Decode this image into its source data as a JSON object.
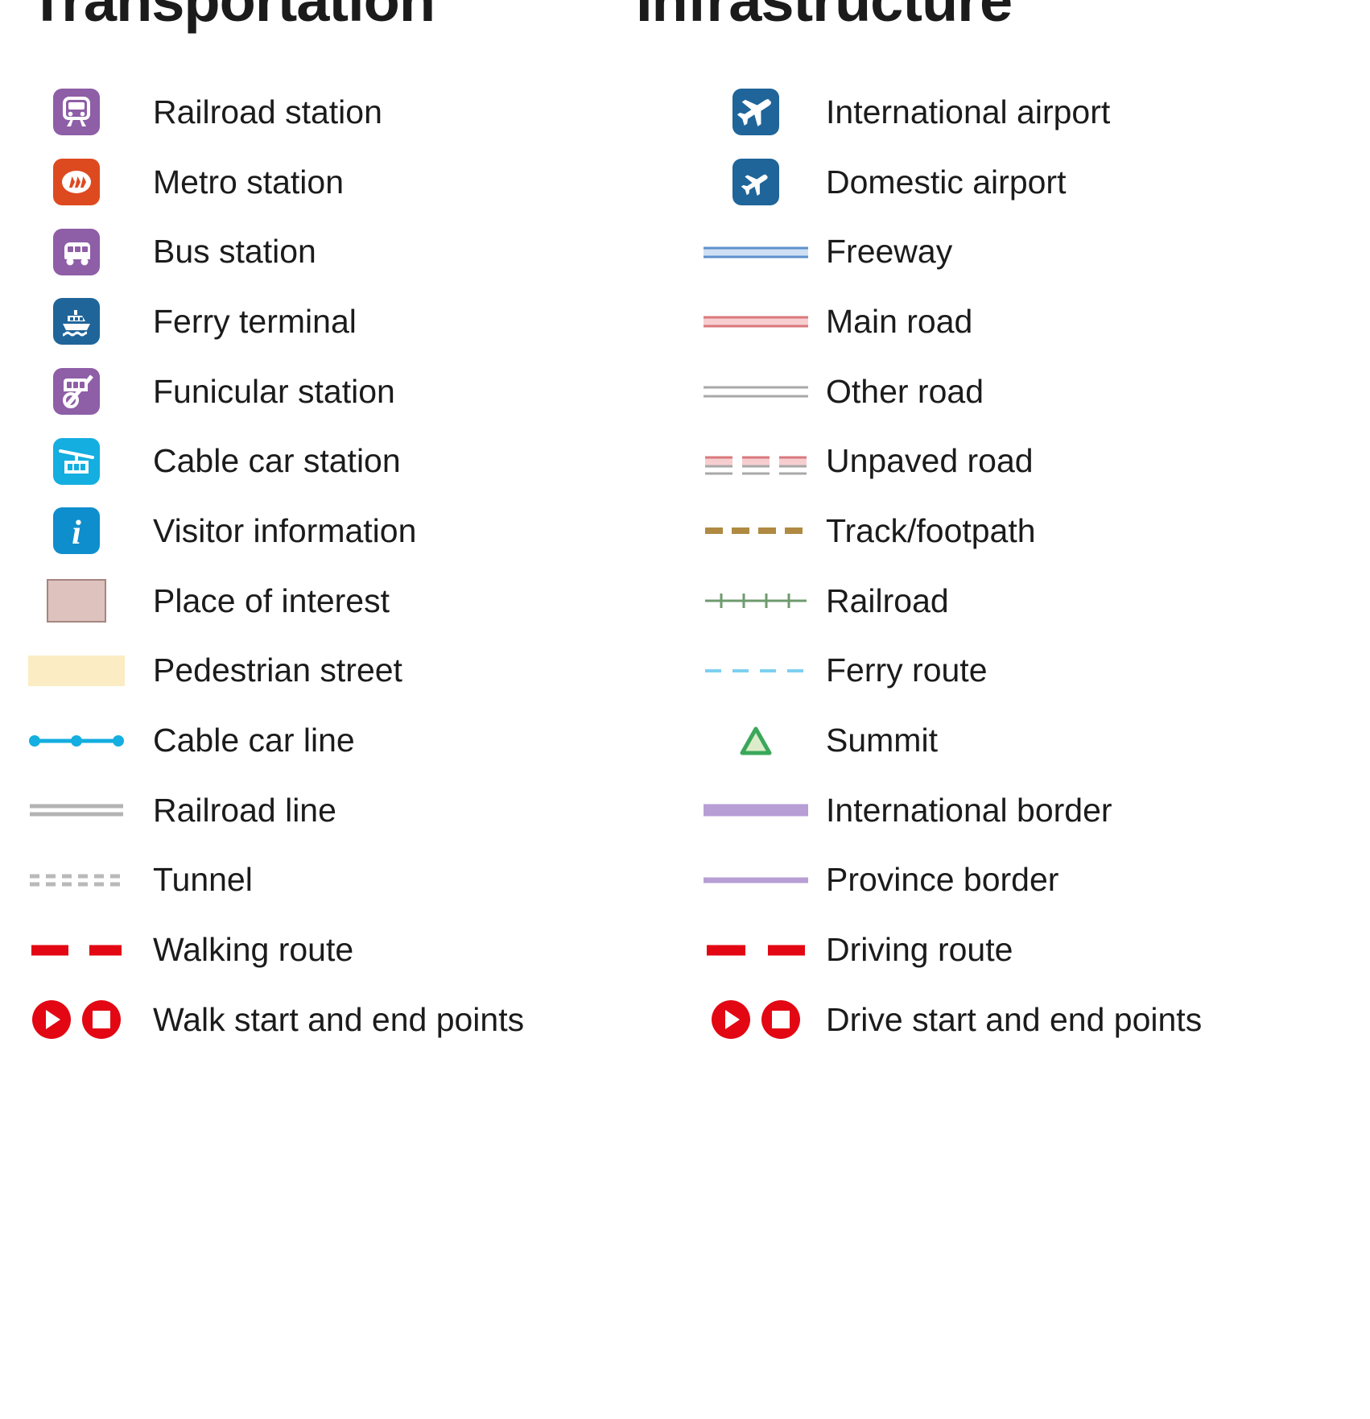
{
  "headers": {
    "left_title": "Transportation",
    "right_title": "Infrastructure"
  },
  "colors": {
    "rail_purple": "#8e5ea6",
    "metro_orange": "#dd4a20",
    "ferry_blue": "#1f6599",
    "cable_cyan": "#14aee0",
    "info_blue": "#0e8ecd",
    "poi_fill": "#ddc2bd",
    "poi_stroke": "#a58580",
    "pedestrian_yellow": "#fbecc3",
    "railroad_gray": "#b3b3b3",
    "tunnel_gray": "#b9b9b9",
    "route_red": "#e30613",
    "airport_blue": "#1f6599",
    "freeway_fill": "#cfe0f5",
    "freeway_casing": "#5d90cc",
    "mainroad_fill": "#f7ced0",
    "mainroad_casing": "#d9787c",
    "otherroad_casing": "#a8a8a8",
    "track_brown": "#b08a42",
    "railroad_green": "#6f9b6e",
    "ferry_route_blue": "#7dd0f0",
    "summit_green": "#3aa75a",
    "summit_fill": "#dcecc9",
    "intl_border_purple": "#b79ed4",
    "province_border_purple": "#b79ed4"
  },
  "left_column": [
    {
      "icon": "railroad-station-icon",
      "label": "Railroad station"
    },
    {
      "icon": "metro-station-icon",
      "label": "Metro station"
    },
    {
      "icon": "bus-station-icon",
      "label": "Bus station"
    },
    {
      "icon": "ferry-terminal-icon",
      "label": "Ferry terminal"
    },
    {
      "icon": "funicular-station-icon",
      "label": "Funicular station"
    },
    {
      "icon": "cable-car-station-icon",
      "label": "Cable car station"
    },
    {
      "icon": "visitor-information-icon",
      "label": "Visitor information"
    },
    {
      "icon": "place-of-interest-swatch",
      "label": "Place of interest"
    },
    {
      "icon": "pedestrian-street-swatch",
      "label": "Pedestrian street"
    },
    {
      "icon": "cable-car-line-symbol",
      "label": "Cable car line"
    },
    {
      "icon": "railroad-line-symbol",
      "label": "Railroad line"
    },
    {
      "icon": "tunnel-symbol",
      "label": "Tunnel"
    },
    {
      "icon": "walking-route-symbol",
      "label": "Walking route"
    },
    {
      "icon": "walk-start-end-symbol",
      "label": "Walk start and end points"
    }
  ],
  "right_column": [
    {
      "icon": "international-airport-icon",
      "label": "International airport"
    },
    {
      "icon": "domestic-airport-icon",
      "label": "Domestic airport"
    },
    {
      "icon": "freeway-symbol",
      "label": "Freeway"
    },
    {
      "icon": "main-road-symbol",
      "label": "Main road"
    },
    {
      "icon": "other-road-symbol",
      "label": "Other road"
    },
    {
      "icon": "unpaved-road-symbol",
      "label": "Unpaved road"
    },
    {
      "icon": "track-footpath-symbol",
      "label": "Track/footpath"
    },
    {
      "icon": "railroad-symbol",
      "label": "Railroad"
    },
    {
      "icon": "ferry-route-symbol",
      "label": "Ferry route"
    },
    {
      "icon": "summit-symbol",
      "label": "Summit"
    },
    {
      "icon": "international-border-symbol",
      "label": "International border"
    },
    {
      "icon": "province-border-symbol",
      "label": "Province border"
    },
    {
      "icon": "driving-route-symbol",
      "label": "Driving route"
    },
    {
      "icon": "drive-start-end-symbol",
      "label": "Drive start and end points"
    }
  ]
}
